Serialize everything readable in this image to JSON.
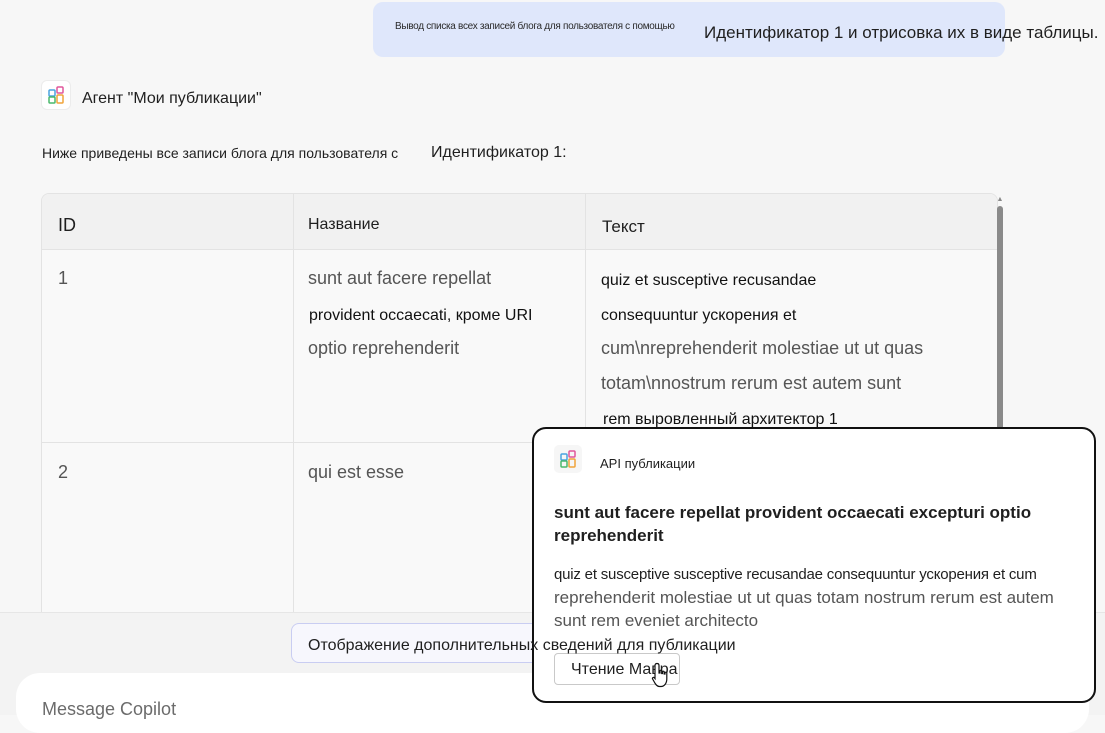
{
  "user_message": {
    "part_a": "Вывод списка всех записей блога для пользователя с помощью",
    "part_b": "Идентификатор 1 и отрисовка их в виде таблицы."
  },
  "agent": {
    "name": "Агент \"Мои публикации\"",
    "icon": "apps-grid-icon"
  },
  "intro": {
    "part_a": "Ниже приведены все записи блога для пользователя с",
    "part_b": "Идентификатор 1:"
  },
  "table": {
    "headers": [
      "ID",
      "Название",
      "Текст"
    ],
    "rows": [
      {
        "id": "1",
        "title_lines": [
          "sunt aut facere repellat",
          "provident occaecati, кроме URI",
          "optio reprehenderit"
        ],
        "text_lines": [
          "quiz et susceptive recusandae",
          "consequuntur ускорения et",
          "cum\\nreprehenderit molestiae ut ut quas",
          "totam\\nnostrum rerum est autem sunt",
          "rem выровленный архитектор 1"
        ]
      },
      {
        "id": "2",
        "title_lines": [
          "qui est esse"
        ],
        "text_lines": []
      }
    ]
  },
  "suggestion": {
    "label": "Отображение дополнительных сведений для публикации"
  },
  "composer": {
    "placeholder": "Message Copilot"
  },
  "hover_card": {
    "app_name": "API публикации",
    "icon": "apps-grid-icon",
    "title": "sunt aut facere repellat provident occaecati excepturi optio reprehenderit",
    "body_a": "quiz et susceptive susceptive recusandae consequuntur ускорения et cum",
    "body_b": "reprehenderit molestiae ut ut quas totam nostrum rerum est autem sunt rem eveniet architecto",
    "button_label": "Чтение Мавра"
  },
  "colors": {
    "user_bubble": "#dfe7fb",
    "page_bg": "#f7f7f7",
    "card_border": "#111111",
    "pill_border": "#c9cdf2"
  }
}
